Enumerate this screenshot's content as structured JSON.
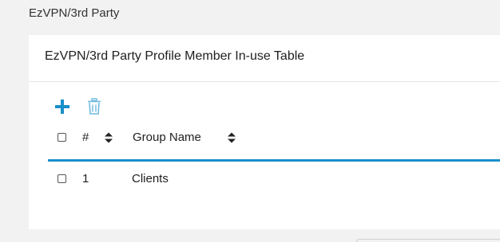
{
  "page": {
    "title": "EzVPN/3rd Party"
  },
  "card": {
    "title": "EzVPN/3rd Party Profile Member In-use Table"
  },
  "toolbar": {
    "add_icon": "plus-icon",
    "delete_icon": "trash-icon",
    "accent_color": "#1a8fc9"
  },
  "table": {
    "columns": [
      {
        "label": "#",
        "sortable": true
      },
      {
        "label": "Group Name",
        "sortable": true
      }
    ],
    "rows": [
      {
        "index": "1",
        "group_name": "Clients",
        "checked": false
      }
    ]
  }
}
